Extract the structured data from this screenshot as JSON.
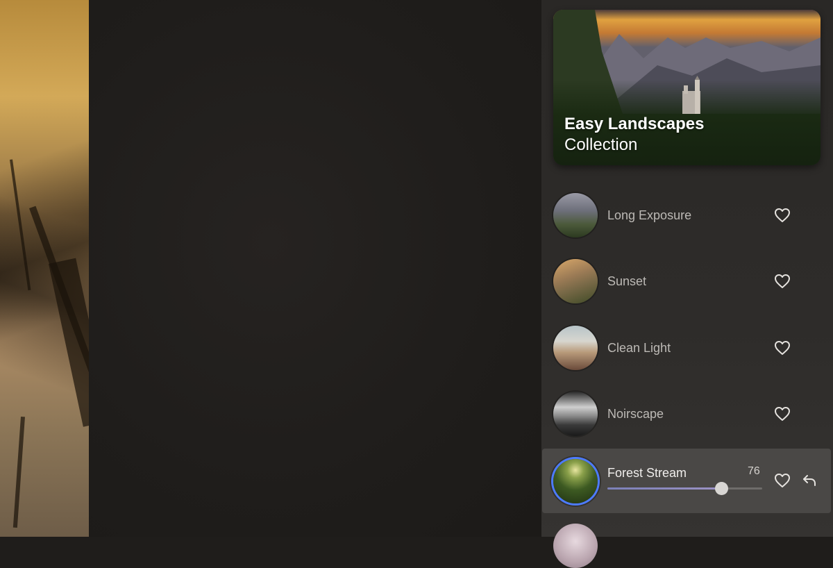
{
  "collection": {
    "title_bold": "Easy Landscapes",
    "title_rest": "Collection"
  },
  "presets": [
    {
      "name": "Long Exposure",
      "icon": "heart-icon",
      "favorited": false
    },
    {
      "name": "Sunset",
      "icon": "heart-icon",
      "favorited": false
    },
    {
      "name": "Clean Light",
      "icon": "heart-icon",
      "favorited": false
    },
    {
      "name": "Noirscape",
      "icon": "heart-icon",
      "favorited": false
    },
    {
      "name": "Forest Stream",
      "icon": "heart-icon",
      "favorited": false,
      "active": true,
      "amount": 76,
      "amount_label": "76"
    }
  ],
  "colors": {
    "accent": "#4d7bff",
    "slider_fill": "#8a8cc0",
    "panel_bg": "#2e2c2a",
    "active_row_bg": "#4a4846"
  },
  "icons": {
    "undo": "undo-icon",
    "favorite": "heart-icon"
  }
}
